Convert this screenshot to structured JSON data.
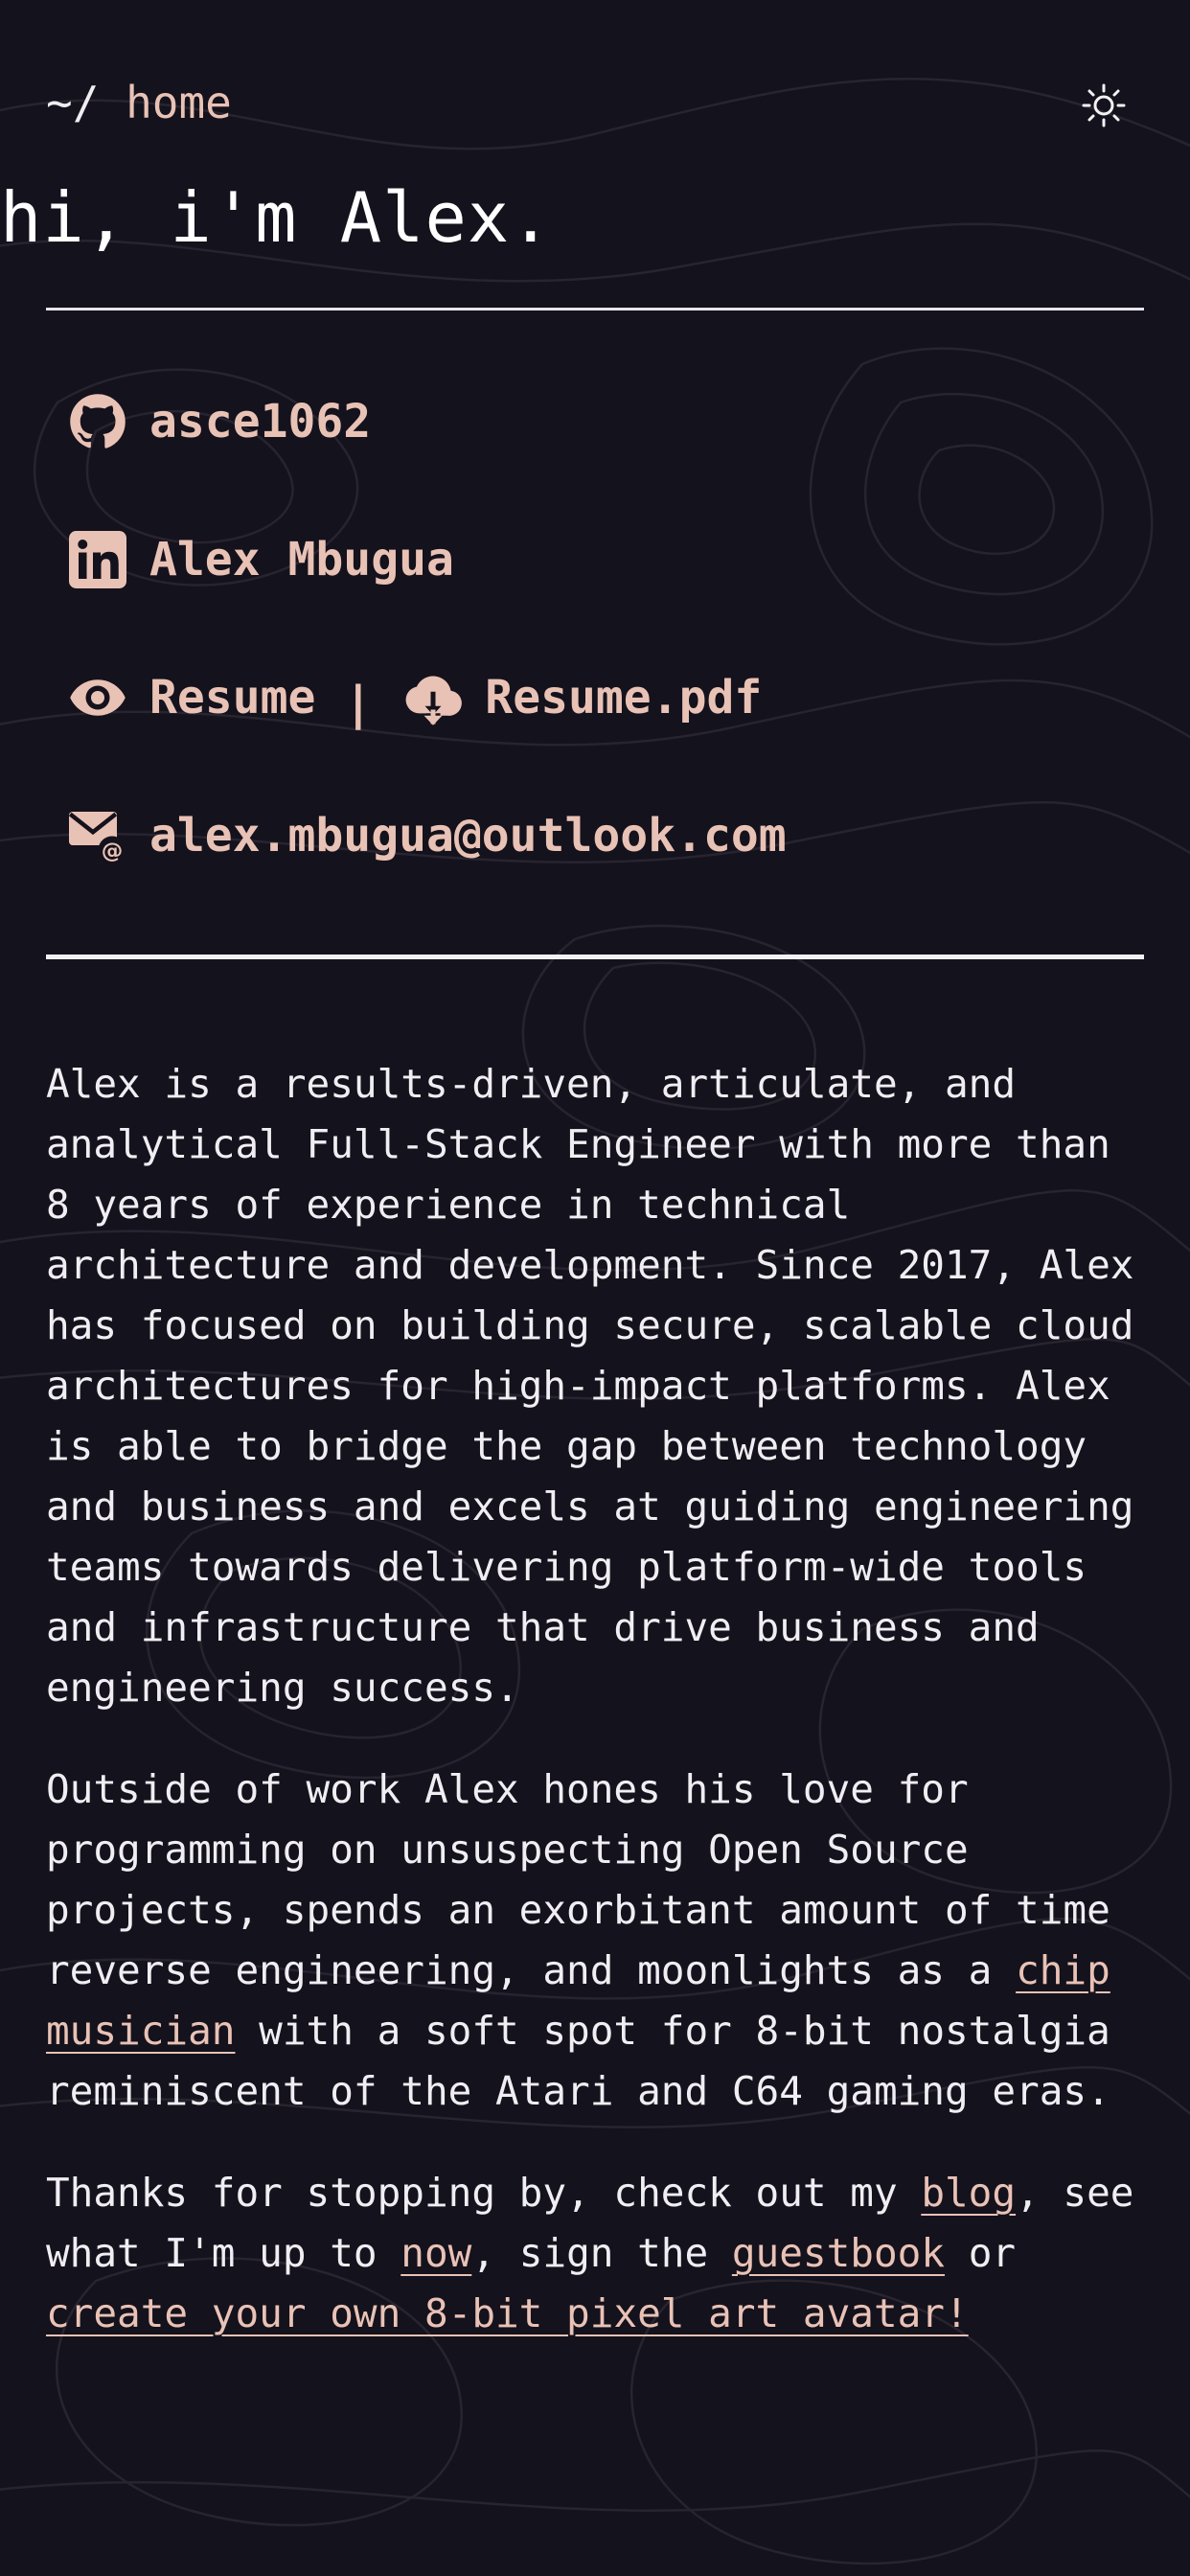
{
  "header": {
    "breadcrumb_prefix": "~/ ",
    "breadcrumb_home": "home",
    "title": "hi, i'm Alex."
  },
  "links": {
    "github": {
      "label": "asce1062",
      "icon": "github-icon"
    },
    "linkedin": {
      "label": "Alex Mbugua",
      "icon": "linkedin-icon"
    },
    "resume_view": {
      "label": "Resume",
      "icon": "eye-icon"
    },
    "separator": "|",
    "resume_pdf": {
      "label": "Resume.pdf",
      "icon": "cloud-download-icon"
    },
    "email": {
      "label": "alex.mbugua@outlook.com",
      "icon": "email-icon"
    }
  },
  "bio": {
    "p1": "Alex is a results-driven, articulate, and analytical Full-Stack Engineer with more than 8 years of experience in technical architecture and development. Since 2017, Alex has focused on building secure, scalable cloud architectures for high-impact platforms. Alex is able to bridge the gap between technology and business and excels at guiding engineering teams towards delivering platform-wide tools and infrastructure that drive business and engineering success.",
    "p2_before": "Outside of work Alex hones his love for programming on unsuspecting Open Source projects, spends an exorbitant amount of time reverse engineering, and moonlights as a ",
    "p2_link": "chip musician",
    "p2_after": " with a soft spot for 8-bit nostalgia reminiscent of the Atari and C64 gaming eras.",
    "p3_a": "Thanks for stopping by, check out my ",
    "p3_blog": "blog",
    "p3_b": ", see what I'm up to ",
    "p3_now": "now",
    "p3_c": ", sign the ",
    "p3_guestbook": "guestbook",
    "p3_d": " or ",
    "p3_avatar": "create your own 8-bit pixel art avatar!"
  },
  "colors": {
    "background": "#14121c",
    "accent": "#e9c2b6",
    "text": "#f0eef2"
  },
  "theme_toggle_icon": "sun-icon"
}
